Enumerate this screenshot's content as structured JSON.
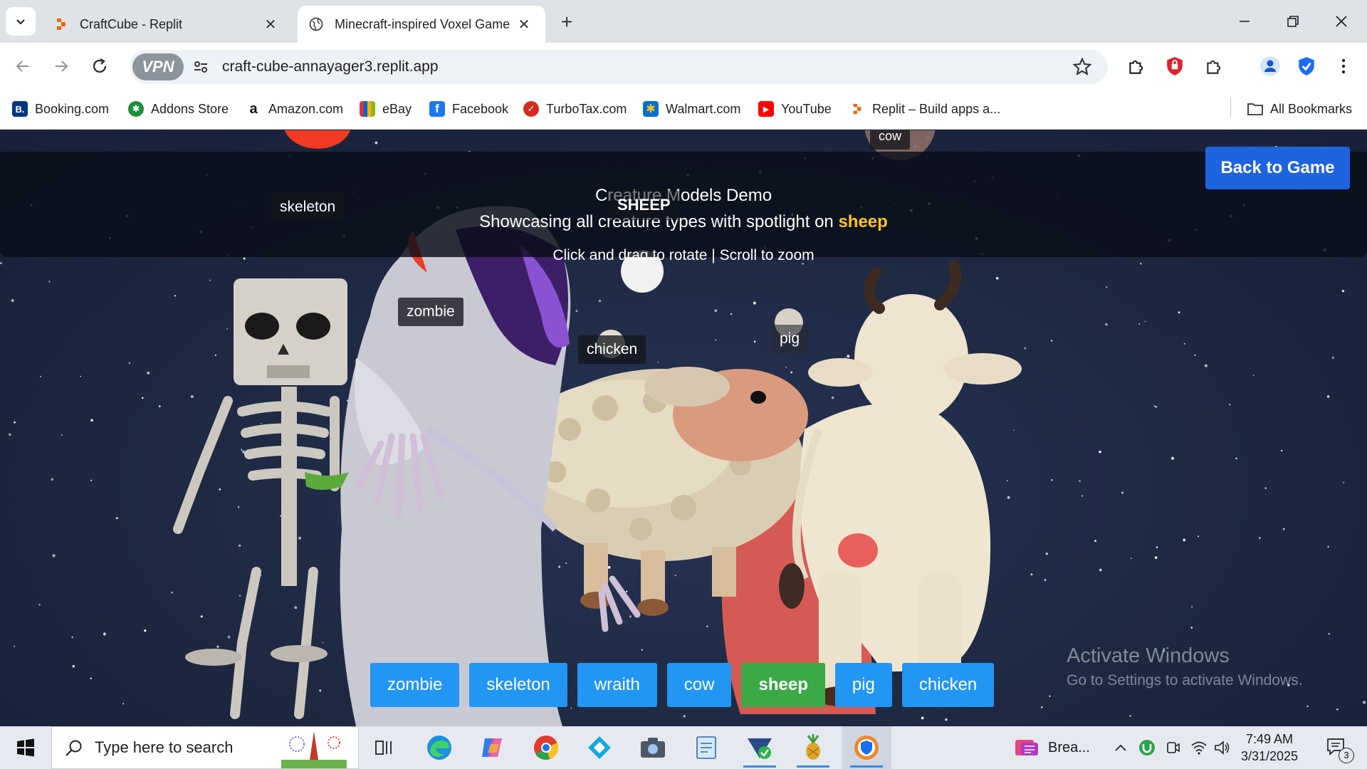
{
  "browser": {
    "tabs": [
      {
        "title": "CraftCube - Replit",
        "active": false,
        "favicon": "replit-icon"
      },
      {
        "title": "Minecraft-inspired Voxel Game",
        "active": true,
        "favicon": "globe-icon"
      }
    ],
    "url": "craft-cube-annayager3.replit.app",
    "vpn_label": "VPN",
    "bookmarks": [
      {
        "label": "Booking.com",
        "icon": "booking-icon",
        "color": "#003580"
      },
      {
        "label": "Addons Store",
        "icon": "addons-icon",
        "color": "#1e8e3e"
      },
      {
        "label": "Amazon.com",
        "icon": "amazon-icon",
        "color": "#222222"
      },
      {
        "label": "eBay",
        "icon": "ebay-icon",
        "color": "#e53238"
      },
      {
        "label": "Facebook",
        "icon": "facebook-icon",
        "color": "#1877f2"
      },
      {
        "label": "TurboTax.com",
        "icon": "turbotax-icon",
        "color": "#d52b1e"
      },
      {
        "label": "Walmart.com",
        "icon": "walmart-icon",
        "color": "#0071ce"
      },
      {
        "label": "YouTube",
        "icon": "youtube-icon",
        "color": "#ff0000"
      },
      {
        "label": "Replit – Build apps a...",
        "icon": "replit-icon",
        "color": "#f26207"
      }
    ],
    "all_bookmarks": "All Bookmarks"
  },
  "game": {
    "hud": {
      "title": "Creature Models Demo",
      "subtitle_prefix": "Showcasing all creature types with spotlight on",
      "spotlight": "sheep",
      "help": "Click and drag to rotate | Scroll to zoom"
    },
    "back_button": "Back to Game",
    "name_tags": {
      "skeleton": "skeleton",
      "zombie": "zombie",
      "chicken": "chicken",
      "pig": "pig",
      "cow": "cow",
      "sheep": "SHEEP"
    },
    "creature_buttons": [
      {
        "label": "zombie",
        "selected": false
      },
      {
        "label": "skeleton",
        "selected": false
      },
      {
        "label": "wraith",
        "selected": false
      },
      {
        "label": "cow",
        "selected": false
      },
      {
        "label": "sheep",
        "selected": true
      },
      {
        "label": "pig",
        "selected": false
      },
      {
        "label": "chicken",
        "selected": false
      }
    ],
    "colors": {
      "selected": "#3aa946",
      "button": "#2196f3",
      "highlight": "#ffc61a",
      "back": "#1e63e0"
    }
  },
  "watermark": {
    "line1": "Activate Windows",
    "line2": "Go to Settings to activate Windows."
  },
  "taskbar": {
    "search_placeholder": "Type here to search",
    "pinned_app_label": "Brea...",
    "time": "7:49 AM",
    "date": "3/31/2025",
    "notification_count": "3"
  }
}
